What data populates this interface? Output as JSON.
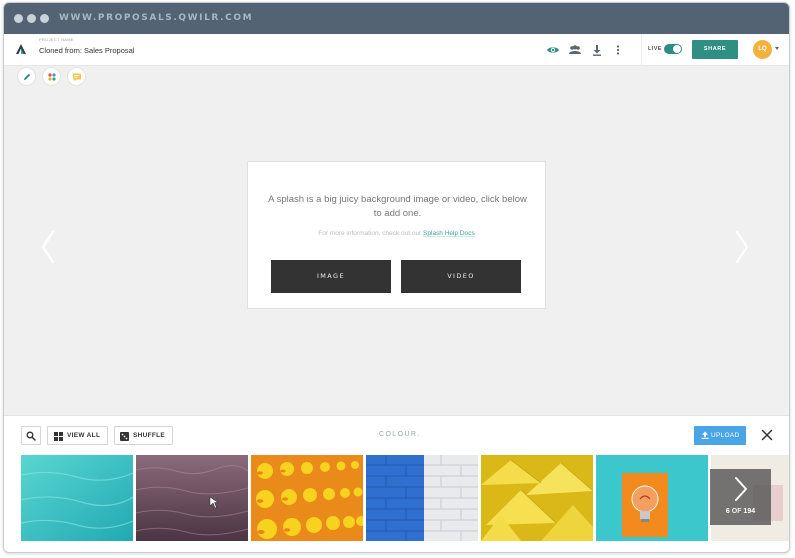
{
  "browser": {
    "url": "WWW.PROPOSALS.QWILR.COM"
  },
  "project": {
    "label": "PROJECT NAME",
    "name": "Cloned from: Sales Proposal"
  },
  "toolbar": {
    "live_label": "LIVE",
    "live_on": true,
    "share_label": "SHARE",
    "avatar_initials": "LQ"
  },
  "splash": {
    "description": "A splash is a big juicy background image or video, click below to add one.",
    "more_info": "For more information, check out our",
    "help_link": "Splash Help Docs",
    "image_button": "IMAGE",
    "video_button": "VIDEO"
  },
  "library": {
    "view_all": "VIEW ALL",
    "shuffle": "SHUFFLE",
    "category": "COLOUR.",
    "upload": "UPLOAD",
    "counter_current": "6",
    "counter_of": "OF",
    "counter_total": "194"
  },
  "colors": {
    "accent": "#2f8f82",
    "upload": "#4aa5e6",
    "titlebar": "#546373",
    "avatar": "#f1b33d"
  }
}
